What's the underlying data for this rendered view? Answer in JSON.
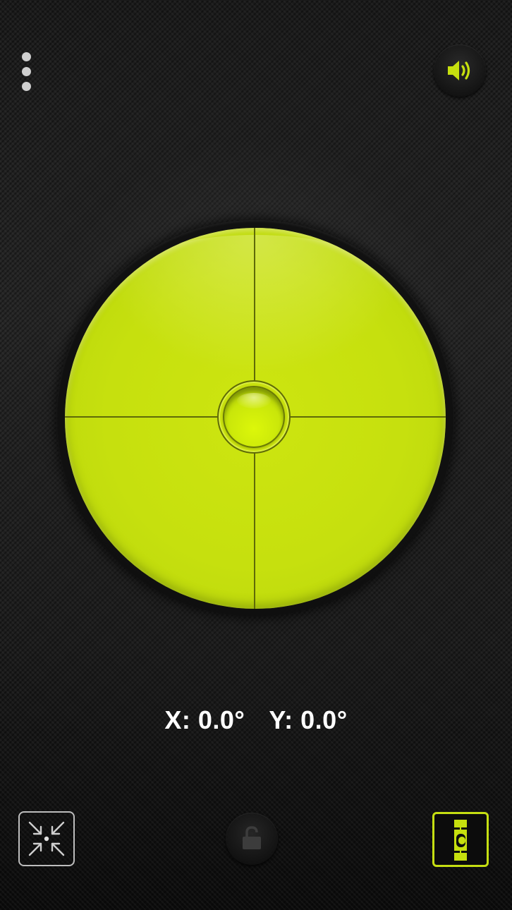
{
  "app": {
    "accent_color": "#c6e00e",
    "background_color": "#1a1a1a"
  },
  "top_bar": {
    "menu_icon": "more-vertical-icon",
    "sound_icon": "speaker-volume-icon"
  },
  "level": {
    "type": "bullseye-level",
    "bubble_icon": "bubble",
    "crosshair": true
  },
  "readout": {
    "x_label": "X: 0.0°",
    "y_label": "Y: 0.0°"
  },
  "bottom_bar": {
    "calibrate_icon": "calibrate-arrows-icon",
    "lock_icon": "padlock-unlocked-icon",
    "mode_icon": "bar-level-icon"
  }
}
